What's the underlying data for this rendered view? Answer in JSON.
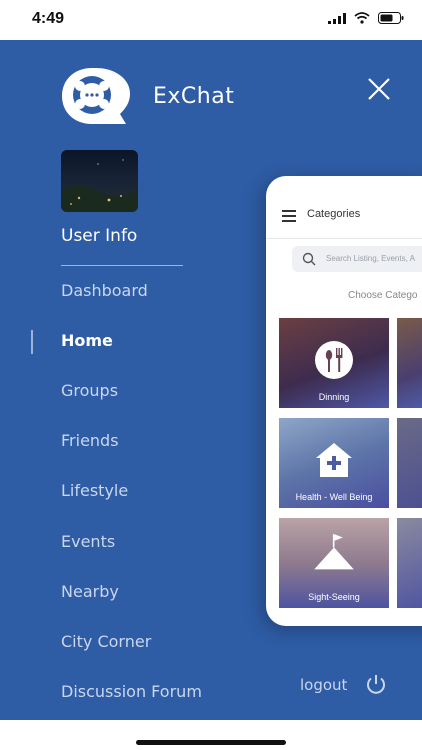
{
  "status_bar": {
    "time": "4:49"
  },
  "drawer": {
    "app_title": "ExChat",
    "user_info": "User Info",
    "menu": [
      {
        "label": "Dashboard",
        "active": false
      },
      {
        "label": "Home",
        "active": true
      },
      {
        "label": "Groups",
        "active": false
      },
      {
        "label": "Friends",
        "active": false
      },
      {
        "label": "Lifestyle",
        "active": false
      },
      {
        "label": "Events",
        "active": false
      },
      {
        "label": "Nearby",
        "active": false
      },
      {
        "label": "City Corner",
        "active": false
      },
      {
        "label": "Discussion Forum",
        "active": false
      }
    ],
    "logout_label": "logout"
  },
  "preview": {
    "title": "Categories",
    "search_placeholder": "Search Listing, Events, A",
    "choose_label": "Choose Catego",
    "tiles": [
      {
        "label": "Dinning",
        "icon": "dining-icon"
      },
      {
        "label": "Health - Well Being",
        "icon": "hospital-icon"
      },
      {
        "label": "Sight-Seeing",
        "icon": "mountain-icon"
      }
    ]
  },
  "colors": {
    "drawer_bg": "#2e5ca5",
    "menu_text": "#c9d6ef",
    "active_text": "#ffffff"
  }
}
